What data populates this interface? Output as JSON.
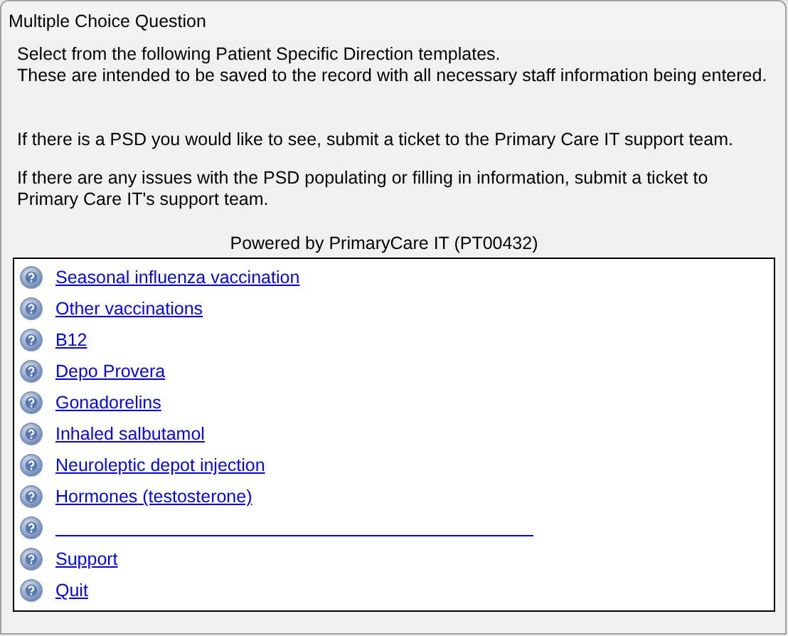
{
  "window": {
    "title": "Multiple Choice Question"
  },
  "intro": [
    "Select from the following Patient Specific Direction templates.\nThese are intended to be saved to the record with all necessary staff information being entered.",
    "If there is a PSD you would like to see, submit a ticket to the Primary Care IT support team.",
    "If there are any issues with the PSD populating or filling in information, submit a ticket to Primary Care IT's support team."
  ],
  "powered_by": "Powered by PrimaryCare IT (PT00432)",
  "options": [
    {
      "kind": "link",
      "label": "Seasonal influenza vaccination"
    },
    {
      "kind": "link",
      "label": "Other vaccinations"
    },
    {
      "kind": "link",
      "label": "B12"
    },
    {
      "kind": "link",
      "label": "Depo Provera"
    },
    {
      "kind": "link",
      "label": "Gonadorelins"
    },
    {
      "kind": "link",
      "label": "Inhaled salbutamol"
    },
    {
      "kind": "link",
      "label": "Neuroleptic depot injection"
    },
    {
      "kind": "link",
      "label": "Hormones (testosterone)"
    },
    {
      "kind": "blank"
    },
    {
      "kind": "link",
      "label": "Support"
    },
    {
      "kind": "link",
      "label": "Quit"
    }
  ]
}
